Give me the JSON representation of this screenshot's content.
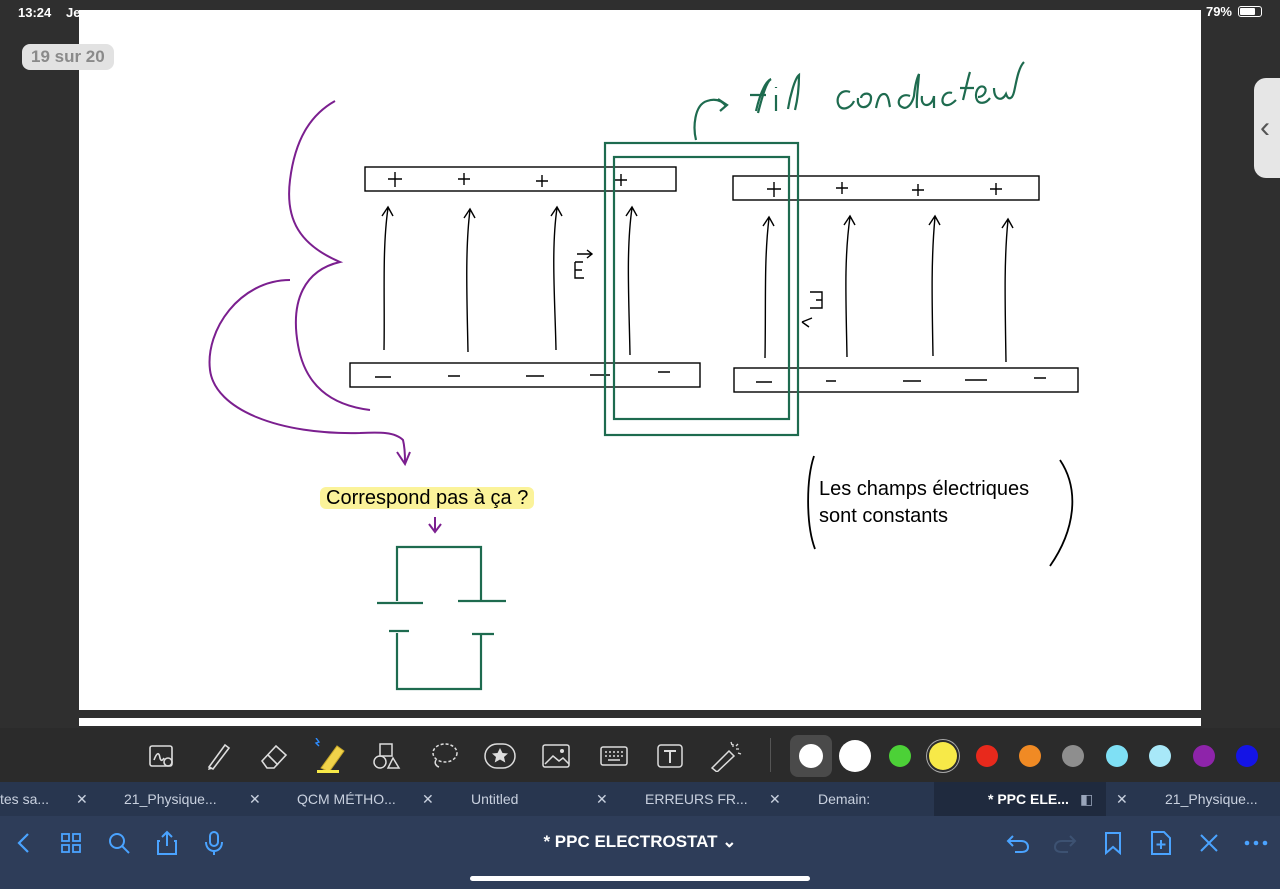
{
  "status_bar": {
    "time": "13:24",
    "date": "Je",
    "battery": "79%"
  },
  "page_indicator": "19 sur 20",
  "note": {
    "handwriting_label": "fil conducteur",
    "field_symbol": "E⃗",
    "question_text": "Correspond pas à ça ?",
    "observation_line1": "Les champs électriques",
    "observation_line2": "sont constants"
  },
  "toolbar": {
    "tools": [
      "zoom-write-icon",
      "pen-icon",
      "eraser-icon",
      "highlighter-icon",
      "shapes-icon",
      "lasso-icon",
      "sticker-icon",
      "image-icon",
      "keyboard-icon",
      "text-box-icon",
      "laser-pointer-icon"
    ],
    "colors": [
      "#ffffff",
      "#ffffff",
      "#4cd137",
      "#f7e948",
      "#e8291c",
      "#f08a24",
      "#8e8e8e",
      "#7fe0f5",
      "#a8e8f8",
      "#8e24aa",
      "#1414e6"
    ],
    "selected_color": "#ffffff"
  },
  "tabs": [
    {
      "label": "tes sa...",
      "active": false
    },
    {
      "label": "21_Physique...",
      "active": false
    },
    {
      "label": "QCM MÉTHO...",
      "active": false
    },
    {
      "label": "Untitled",
      "active": false
    },
    {
      "label": "ERREURS FR...",
      "active": false
    },
    {
      "label": "Demain:",
      "active": false
    },
    {
      "label": "* PPC ELE...",
      "active": true
    },
    {
      "label": "21_Physique...",
      "active": false
    }
  ],
  "bottom_bar": {
    "title": "* PPC ELECTROSTAT ⌄"
  },
  "colors": {
    "ink_green": "#1e6b4f",
    "ink_purple": "#7b1f8f",
    "highlight": "#fbf39a",
    "tabs_bg": "#28364f",
    "bottom_bg": "#2e3d59"
  }
}
